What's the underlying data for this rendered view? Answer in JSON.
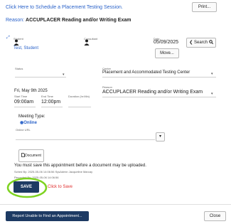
{
  "header": {
    "schedule_link": "Click Here to Schedule a Placement Testing Session.",
    "print_label": "Print...",
    "reason_label": "Reason:",
    "reason_value": "ACCUPLACER Reading and/or Writing Exam"
  },
  "people": {
    "student_caption": "Student",
    "student_name": "Test, Student",
    "consultant_caption": "Consultant",
    "date_caption": "Date",
    "date_value": "05/09/2025",
    "move_label": "Move...",
    "search_label": "Search"
  },
  "form": {
    "status_label": "Status",
    "status_value": "",
    "center_label": "Center",
    "center_value": "Placement and Accommodated Testing Center",
    "date_text": "Fri, May 9th 2025",
    "start_time_label": "Start Time",
    "start_time_value": "09:00am",
    "end_time_label": "End Time",
    "end_time_value": "12:00pm",
    "duration_label": "Duration (hr:Min)",
    "duration_value": "",
    "reason_label": "Reason",
    "reason_value": "ACCUPLACER Reading and/or Writing Exam",
    "meeting_type_label": "Meeting Type:",
    "meeting_type_value": "Online",
    "online_url_label": "Online URL",
    "online_url_value": ""
  },
  "document": {
    "label": "Document",
    "warning": "You must save this appointment before a document may be uploaded."
  },
  "audit": {
    "line1": "Sched By: 2025-05-06 14:06:56 SysAdmin Jacqueline Marcay",
    "line2": "Recorded By: 2025-05-06 14:06:56"
  },
  "actions": {
    "save_label": "SAVE",
    "annotation": "Click to Save",
    "report_label": "Report Unable to Find an Appointment...",
    "close_label": "Close"
  },
  "colors": {
    "link": "#2a62c9",
    "save_bg": "#1d3a63",
    "annotation": "#e03030",
    "highlight_circle": "#7ed321",
    "report_bg": "#1d3a63"
  },
  "icons": {
    "student": "person-icon",
    "consultant": "person-icon",
    "search": "magnifier-icon",
    "back": "chevron-left-icon",
    "document": "document-icon",
    "radio": "radio-selected-icon"
  }
}
